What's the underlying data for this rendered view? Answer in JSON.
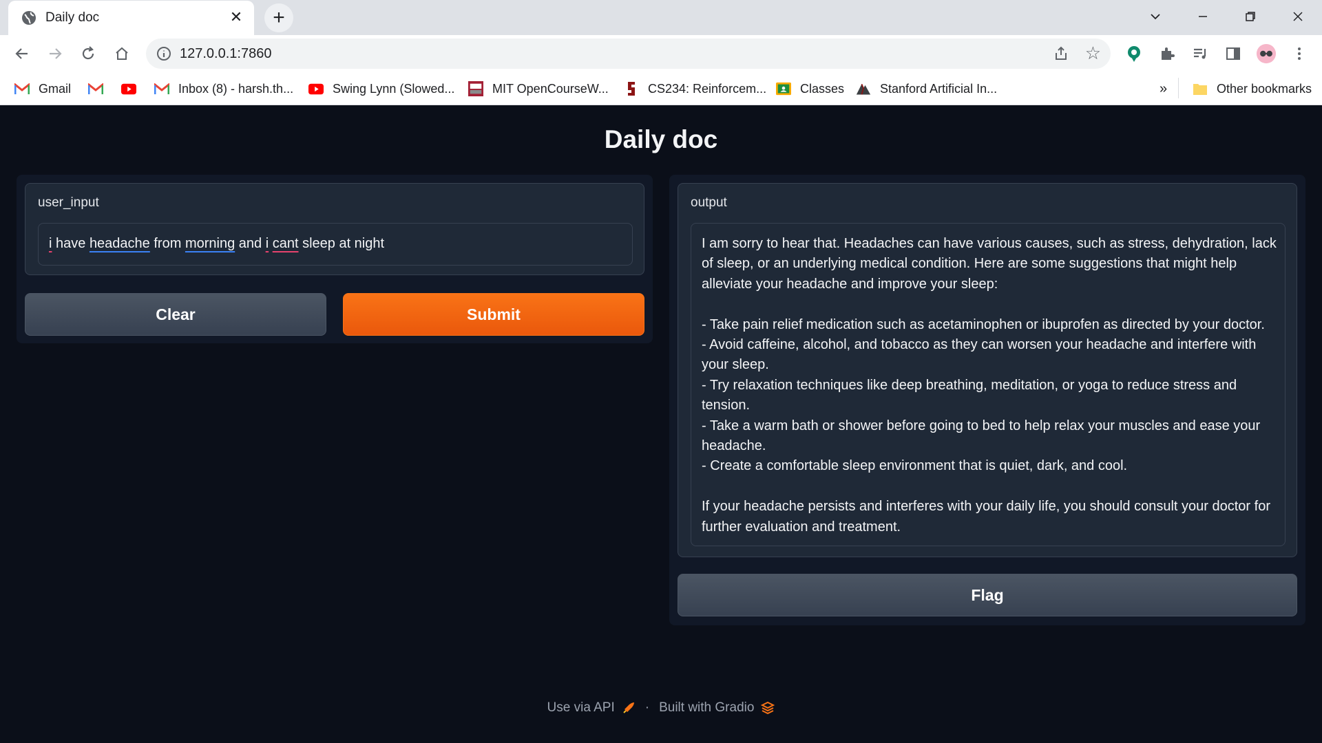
{
  "browser": {
    "tab_title": "Daily doc",
    "new_tab_symbol": "+",
    "url": "127.0.0.1:7860",
    "bookmarks": [
      {
        "label": "Gmail",
        "icon": "gmail-icon"
      },
      {
        "label": "",
        "icon": "gmail-icon"
      },
      {
        "label": "",
        "icon": "youtube-icon"
      },
      {
        "label": "Inbox (8) - harsh.th...",
        "icon": "gmail-icon"
      },
      {
        "label": "Swing Lynn (Slowed...",
        "icon": "youtube-icon"
      },
      {
        "label": "MIT OpenCourseW...",
        "icon": "mit-ocw-icon"
      },
      {
        "label": "CS234: Reinforcem...",
        "icon": "stanford-icon"
      },
      {
        "label": "Classes",
        "icon": "classroom-icon"
      },
      {
        "label": "Stanford Artificial In...",
        "icon": "stanford-ai-icon"
      }
    ],
    "more_bookmarks": "»",
    "other_bookmarks": "Other bookmarks"
  },
  "app": {
    "title": "Daily doc",
    "input": {
      "label": "user_input",
      "words": [
        "i",
        " have ",
        "headache",
        " from ",
        "morning",
        " and ",
        "i",
        " ",
        "cant",
        " sleep at night"
      ]
    },
    "buttons": {
      "clear": "Clear",
      "submit": "Submit",
      "flag": "Flag"
    },
    "output": {
      "label": "output",
      "paragraph1": "I am sorry to hear that. Headaches can have various causes, such as stress, dehydration, lack of sleep, or an underlying medical condition. Here are some suggestions that might help alleviate your headache and improve your sleep:",
      "bullets": [
        "- Take pain relief medication such as acetaminophen or ibuprofen as directed by your doctor.",
        "- Avoid caffeine, alcohol, and tobacco as they can worsen your headache and interfere with your sleep.",
        "- Try relaxation techniques like deep breathing, meditation, or yoga to reduce stress and tension.",
        "- Take a warm bath or shower before going to bed to help relax your muscles and ease your headache.",
        "- Create a comfortable sleep environment that is quiet, dark, and cool."
      ],
      "paragraph2": "If your headache persists and interferes with your daily life, you should consult your doctor for further evaluation and treatment."
    },
    "footer": {
      "api_link": "Use via API",
      "separator": "·",
      "built_with": "Built with Gradio"
    }
  },
  "colors": {
    "accent": "#f97316",
    "background": "#0b0f19",
    "panel": "#1f2937"
  }
}
